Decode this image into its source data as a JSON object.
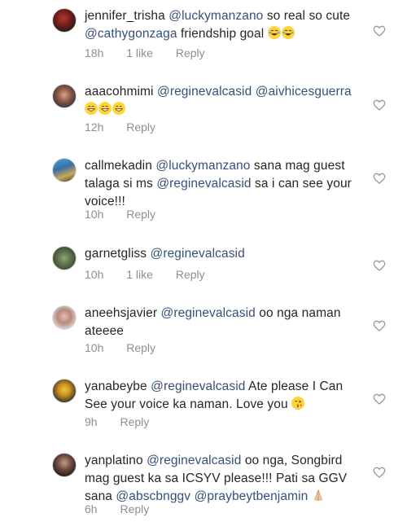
{
  "comments": [
    {
      "username": "jennifer_trisha",
      "text_parts": [
        "@luckymanzano",
        " so real so cute ",
        "@cathygonzaga",
        " friendship goal"
      ],
      "emojis": [
        "face-with-tears-of-joy",
        "face-with-tears-of-joy"
      ],
      "time": "18h",
      "likes": "1 like",
      "reply": "Reply"
    },
    {
      "username": "aaacohmimi",
      "text_parts": [
        "@reginevalcasid",
        " ",
        "@aivhicesguerra"
      ],
      "emojis": [
        "grinning-face",
        "grinning-face",
        "grinning-face"
      ],
      "time": "12h",
      "likes": "",
      "reply": "Reply"
    },
    {
      "username": "callmekadin",
      "text_parts": [
        "@luckymanzano",
        " sana mag guest talaga si ms ",
        "@reginevalcasid",
        " sa i can see your voice!!!"
      ],
      "emojis": [],
      "time": "10h",
      "likes": "",
      "reply": "Reply"
    },
    {
      "username": "garnetgliss",
      "text_parts": [
        "@reginevalcasid"
      ],
      "emojis": [],
      "time": "10h",
      "likes": "1 like",
      "reply": "Reply"
    },
    {
      "username": "aneehsjavier",
      "text_parts": [
        "@reginevalcasid",
        " oo nga naman ateeee"
      ],
      "emojis": [],
      "time": "10h",
      "likes": "",
      "reply": "Reply"
    },
    {
      "username": "yanabeybe",
      "text_parts": [
        "@reginevalcasid",
        " Ate please I Can See your voice ka naman. Love you "
      ],
      "emojis": [
        "face-blowing-kiss"
      ],
      "time": "9h",
      "likes": "",
      "reply": "Reply"
    },
    {
      "username": "yanplatino",
      "text_parts": [
        "@reginevalcasid",
        " oo nga, Songbird mag guest ka sa ICSYV please!!! Pati sa GGV sana ",
        "@abscbnggv",
        " ",
        "@praybeytbenjamin"
      ],
      "emojis": [
        "folded-hands"
      ],
      "time": "6h",
      "likes": "",
      "reply": "Reply"
    }
  ],
  "icons": {
    "like": "heart-outline-icon"
  },
  "colors": {
    "mention": "#35507a",
    "meta": "#8e8e8e",
    "text": "#262626"
  }
}
